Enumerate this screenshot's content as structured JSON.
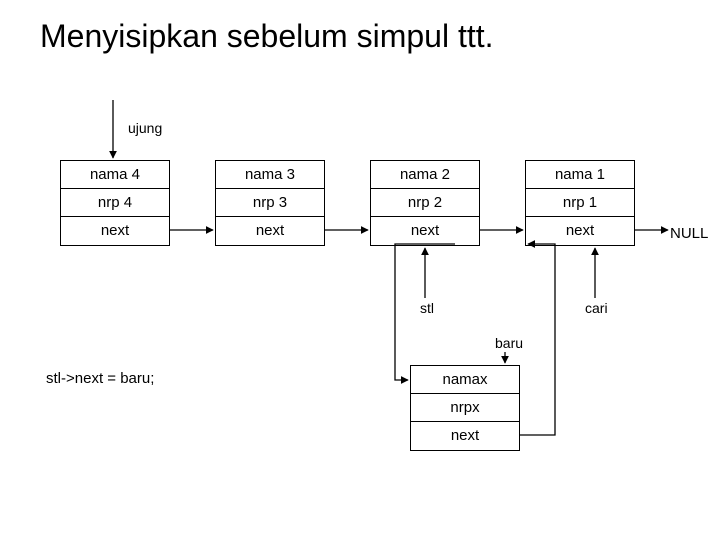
{
  "title": "Menyisipkan sebelum simpul ttt.",
  "labels": {
    "ujung": "ujung",
    "stl": "stl",
    "cari": "cari",
    "baru": "baru",
    "null": "NULL"
  },
  "code": "stl->next = baru;",
  "nodes": [
    {
      "nama": "nama 4",
      "nrp": "nrp 4",
      "next": "next"
    },
    {
      "nama": "nama 3",
      "nrp": "nrp 3",
      "next": "next"
    },
    {
      "nama": "nama 2",
      "nrp": "nrp 2",
      "next": "next"
    },
    {
      "nama": "nama 1",
      "nrp": "nrp 1",
      "next": "next"
    }
  ],
  "newnode": {
    "nama": "namax",
    "nrp": "nrpx",
    "next": "next"
  }
}
